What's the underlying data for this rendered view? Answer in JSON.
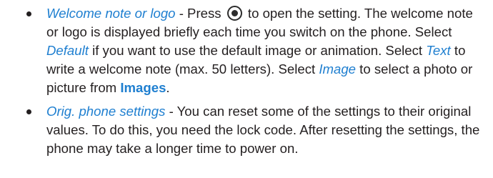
{
  "items": [
    {
      "term": "Welcome note or logo",
      "dash": " - Press ",
      "key_icon": "nav-key-icon",
      "after_key": " to open the setting. The welcome note or logo is displayed briefly each time you switch on the phone. Select ",
      "opt_default": "Default",
      "after_default": " if you want to use the default image or animation. Select ",
      "opt_text": "Text",
      "after_text": " to write a welcome note (max. 50 letters). Select ",
      "opt_image": "Image",
      "after_image": " to select a photo or picture from ",
      "images_link": "Images",
      "end": "."
    },
    {
      "term": "Orig. phone settings",
      "body": " - You can reset some of the settings to their original values. To do this, you need the lock code. After resetting the settings, the phone may take a longer time to power on."
    }
  ]
}
